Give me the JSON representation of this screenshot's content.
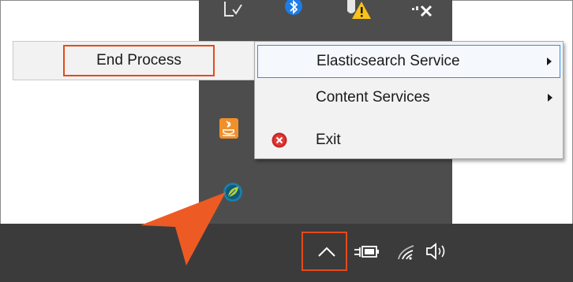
{
  "end_menu": {
    "end_process_label": "End Process"
  },
  "context_menu": {
    "items": [
      {
        "label": "Elasticsearch Service",
        "has_submenu": true,
        "highlighted": true
      },
      {
        "label": "Content Services",
        "has_submenu": true,
        "highlighted": false
      },
      {
        "label": "Exit",
        "has_submenu": false,
        "icon": "exit-x-icon"
      }
    ]
  },
  "tray_overflow_icons": [
    "document-check-icon",
    "bluetooth-icon",
    "warning-shield-icon",
    "network-x-icon",
    "java-icon",
    "app-leaf-icon"
  ],
  "taskbar": {
    "icons": [
      "chevron-up-icon",
      "battery-plug-icon",
      "wifi-icon",
      "volume-icon"
    ]
  },
  "colors": {
    "highlight": "#e64a19",
    "menu_selection_border": "#2e8ff0",
    "tray_background": "#4d4d4d",
    "taskbar_background": "#3b3b3b"
  }
}
